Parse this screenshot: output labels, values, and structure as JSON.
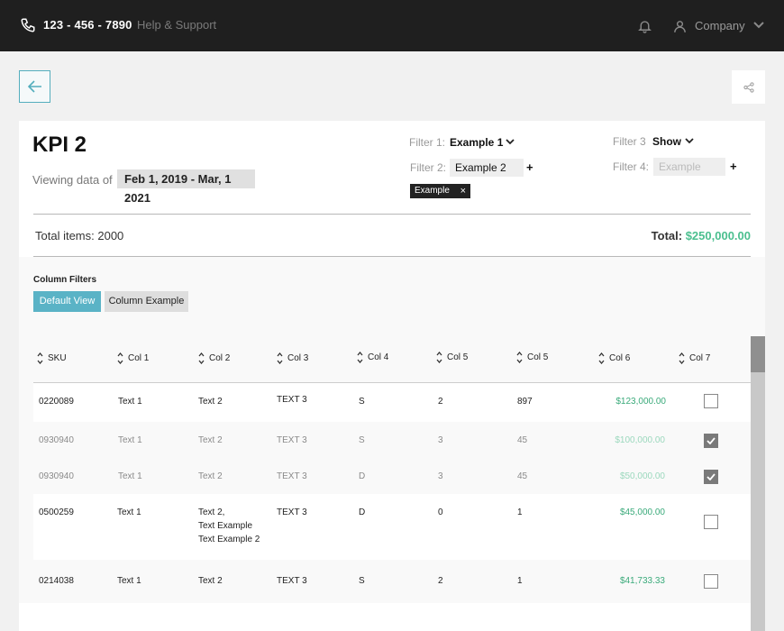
{
  "topbar": {
    "phone": "123 - 456 - 7890",
    "help": "Help & Support",
    "company": "Company",
    "icons": [
      "phone-icon",
      "bell-icon",
      "user-icon",
      "chevron-down-icon"
    ]
  },
  "header": {
    "title": "KPI 2",
    "viewing_label": "Viewing data of",
    "date_range": "Feb 1, 2019 - Mar, 1 2021"
  },
  "filters": {
    "f1_label": "Filter 1:",
    "f1_value": "Example 1",
    "f2_label": "Filter 2:",
    "f2_value": "Example 2",
    "f2_tag": "Example",
    "f3_label": "Filter 3",
    "f3_value": "Show",
    "f4_label": "Filter 4:",
    "f4_placeholder": "Example",
    "plus": "+",
    "tag_close": "×"
  },
  "summary": {
    "total_items": "Total items: 2000",
    "total_label": "Total:",
    "total_amount": "$250,000.00"
  },
  "column_filters": {
    "label": "Column Filters",
    "default_view": "Default View",
    "column_example": "Column Example"
  },
  "table": {
    "headers": [
      "SKU",
      "Col 1",
      "Col 2",
      "Col 3",
      "Col 4",
      "Col 5",
      "Col 5",
      "Col 6",
      "Col 7"
    ],
    "rows": [
      {
        "sku": "0220089",
        "c1": "Text 1",
        "c2": "Text 2",
        "c3": "TEXT 3",
        "c4": "S",
        "c5a": "2",
        "c5b": "897",
        "c6": "$123,000.00",
        "checked": false
      },
      {
        "sku": "0930940",
        "c1": "Text 1",
        "c2": "Text 2",
        "c3": "TEXT 3",
        "c4": "S",
        "c5a": "3",
        "c5b": "45",
        "c6": "$100,000.00",
        "checked": true
      },
      {
        "sku": "0930940",
        "c1": "Text 1",
        "c2": "Text 2",
        "c3": "TEXT 3",
        "c4": "D",
        "c5a": "3",
        "c5b": "45",
        "c6": "$50,000.00",
        "checked": true
      },
      {
        "sku": "0500259",
        "c1": "Text 1",
        "c2_lines": [
          "Text 2,",
          "Text Example",
          "Text Example 2"
        ],
        "c3": "TEXT 3",
        "c4": "D",
        "c5a": "0",
        "c5b": "1",
        "c6": "$45,000.00",
        "checked": false
      },
      {
        "sku": "0214038",
        "c1": "Text 1",
        "c2": "Text 2",
        "c3": "TEXT 3",
        "c4": "S",
        "c5a": "2",
        "c5b": "1",
        "c6": "$41,733.33",
        "checked": false
      }
    ]
  },
  "colors": {
    "accent": "#5ab3c6",
    "money": "#3aaa7a",
    "topbar": "#1f1f1f"
  }
}
